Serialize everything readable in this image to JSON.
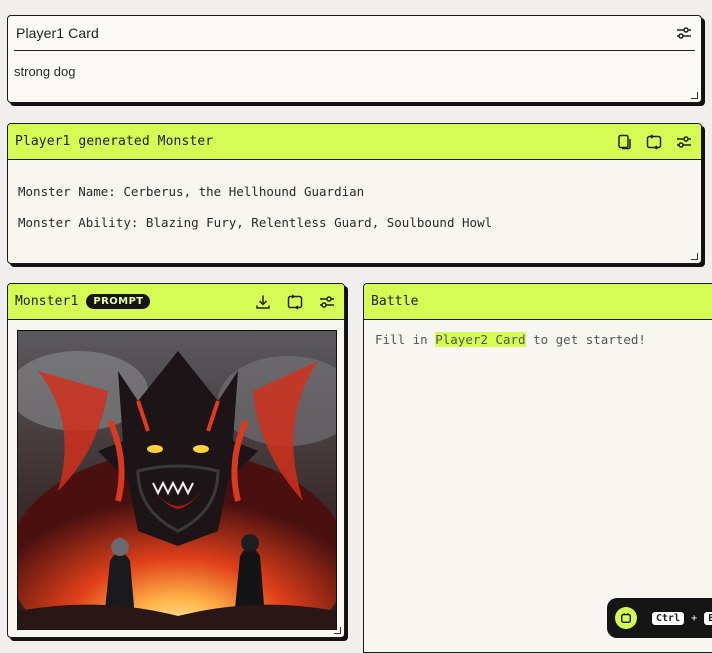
{
  "player1_card": {
    "title": "Player1 Card",
    "value": "strong dog",
    "settings_icon": "sliders-icon"
  },
  "generated_monster": {
    "title": "Player1 generated Monster",
    "name_line": "Monster Name: Cerberus, the Hellhound Guardian",
    "ability_line": "Monster Ability: Blazing Fury, Relentless Guard, Soulbound Howl",
    "icons": [
      "copy-icon",
      "refresh-icon",
      "sliders-icon"
    ]
  },
  "monster1": {
    "title": "Monster1",
    "badge": "PROMPT",
    "icons": [
      "download-icon",
      "refresh-icon",
      "sliders-icon"
    ],
    "image_description_icon": "monster-image"
  },
  "battle": {
    "title": "Battle",
    "prefix": "Fill in",
    "highlight": "Player2 Card",
    "suffix": "to get started!"
  },
  "shortcut": {
    "key1": "Ctrl",
    "plus": "+",
    "key2": "En"
  },
  "colors": {
    "accent": "#d5fb54",
    "panel": "#f8f6f0",
    "border": "#1a1a1a"
  }
}
